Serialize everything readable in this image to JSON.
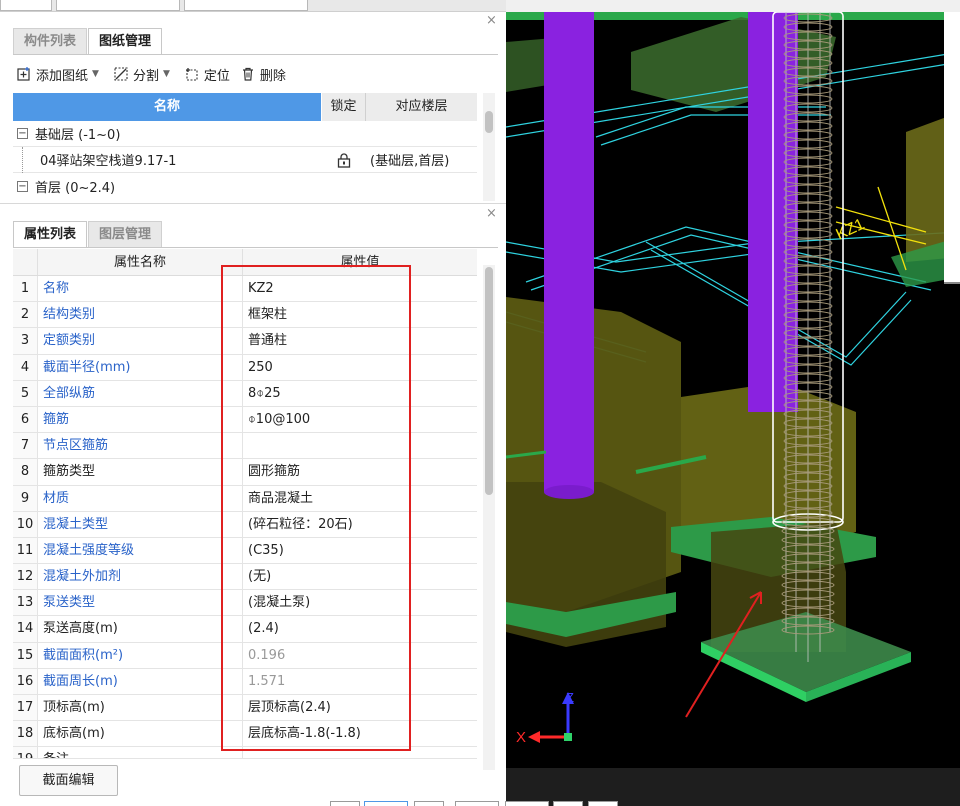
{
  "components_panel": {
    "tabs": [
      "构件列表",
      "图纸管理"
    ],
    "active_tab": 1,
    "toolbar": [
      {
        "label": "添加图纸",
        "has_dropdown": true,
        "icon": "add-drawing-icon"
      },
      {
        "label": "分割",
        "has_dropdown": true,
        "icon": "split-icon"
      },
      {
        "label": "定位",
        "has_dropdown": false,
        "icon": "locate-icon"
      },
      {
        "label": "删除",
        "has_dropdown": false,
        "icon": "trash-icon"
      }
    ],
    "table": {
      "headers": {
        "name": "名称",
        "lock": "锁定",
        "floor": "对应楼层"
      },
      "rows": [
        {
          "type": "group",
          "label": "基础层 (-1~0)"
        },
        {
          "type": "item",
          "label": "04驿站架空栈道9.17-1",
          "locked": true,
          "floor": "(基础层,首层)"
        },
        {
          "type": "group",
          "label": "首层 (0~2.4)"
        }
      ]
    }
  },
  "properties_panel": {
    "tabs": [
      "属性列表",
      "图层管理"
    ],
    "active_tab": 0,
    "headers": {
      "name": "属性名称",
      "value": "属性值"
    },
    "rows": [
      {
        "n": "1",
        "name": "名称",
        "value": "KZ2",
        "name_blue": true,
        "value_grey": false
      },
      {
        "n": "2",
        "name": "结构类别",
        "value": "框架柱",
        "name_blue": true,
        "value_grey": false
      },
      {
        "n": "3",
        "name": "定额类别",
        "value": "普通柱",
        "name_blue": true,
        "value_grey": false
      },
      {
        "n": "4",
        "name": "截面半径(mm)",
        "value": "250",
        "name_blue": true,
        "value_grey": false
      },
      {
        "n": "5",
        "name": "全部纵筋",
        "value": "8⌽25",
        "name_blue": true,
        "value_grey": false
      },
      {
        "n": "6",
        "name": "箍筋",
        "value": "⌽10@100",
        "name_blue": true,
        "value_grey": false
      },
      {
        "n": "7",
        "name": "节点区箍筋",
        "value": "",
        "name_blue": true,
        "value_grey": false
      },
      {
        "n": "8",
        "name": "箍筋类型",
        "value": "圆形箍筋",
        "name_blue": false,
        "value_grey": false
      },
      {
        "n": "9",
        "name": "材质",
        "value": "商品混凝土",
        "name_blue": true,
        "value_grey": false
      },
      {
        "n": "10",
        "name": "混凝土类型",
        "value": "(碎石粒径：20石)",
        "name_blue": true,
        "value_grey": false
      },
      {
        "n": "11",
        "name": "混凝土强度等级",
        "value": "(C35)",
        "name_blue": true,
        "value_grey": false
      },
      {
        "n": "12",
        "name": "混凝土外加剂",
        "value": "(无)",
        "name_blue": true,
        "value_grey": false
      },
      {
        "n": "13",
        "name": "泵送类型",
        "value": "(混凝土泵)",
        "name_blue": true,
        "value_grey": false
      },
      {
        "n": "14",
        "name": "泵送高度(m)",
        "value": "(2.4)",
        "name_blue": false,
        "value_grey": false
      },
      {
        "n": "15",
        "name": "截面面积(m²)",
        "value": "0.196",
        "name_blue": true,
        "value_grey": true
      },
      {
        "n": "16",
        "name": "截面周长(m)",
        "value": "1.571",
        "name_blue": true,
        "value_grey": true
      },
      {
        "n": "17",
        "name": "顶标高(m)",
        "value": "层顶标高(2.4)",
        "name_blue": false,
        "value_grey": false
      },
      {
        "n": "18",
        "name": "底标高(m)",
        "value": "层底标高-1.8(-1.8)",
        "name_blue": false,
        "value_grey": false
      },
      {
        "n": "19",
        "name": "备注",
        "value": "",
        "name_blue": false,
        "value_grey": false
      }
    ],
    "edit_button": "截面编辑"
  },
  "viewport": {
    "axis_x": "X",
    "axis_z": "Z",
    "element_tag": "KZ1"
  },
  "colors": {
    "accent_header": "#4f98e6",
    "prop_name_blue": "#2a63c9",
    "highlight_red": "#e02020"
  }
}
